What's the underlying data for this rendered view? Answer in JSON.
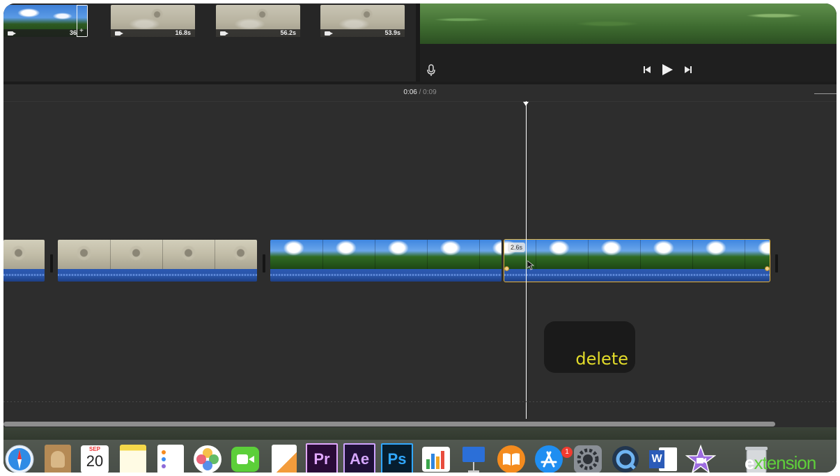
{
  "browser": {
    "clips": [
      {
        "duration": "36",
        "kind": "sky"
      },
      {
        "duration": "16.8s",
        "kind": "water"
      },
      {
        "duration": "56.2s",
        "kind": "water"
      },
      {
        "duration": "53.9s",
        "kind": "water"
      }
    ]
  },
  "viewer": {
    "icons": {
      "mic": "microphone-icon",
      "prev": "skip-back-icon",
      "play": "play-icon",
      "next": "skip-forward-icon"
    }
  },
  "timeline": {
    "current_time": "0:06",
    "separator": "/",
    "total_time": "0:09",
    "selected_clip_duration": "2.6s"
  },
  "tooltip": {
    "text": "delete"
  },
  "dock": {
    "apps": [
      {
        "name": "Safari",
        "icon": "safari-icon"
      },
      {
        "name": "Contacts",
        "icon": "contacts-icon"
      },
      {
        "name": "Calendar",
        "icon": "calendar-icon",
        "month": "SEP",
        "day": "20"
      },
      {
        "name": "Notes",
        "icon": "notes-icon"
      },
      {
        "name": "Reminders",
        "icon": "reminders-icon"
      },
      {
        "name": "Photos",
        "icon": "photos-icon"
      },
      {
        "name": "FaceTime",
        "icon": "facetime-icon"
      },
      {
        "name": "Pages",
        "icon": "pages-icon"
      },
      {
        "name": "Premiere Pro",
        "label": "Pr",
        "icon": "premiere-icon"
      },
      {
        "name": "After Effects",
        "label": "Ae",
        "icon": "after-effects-icon"
      },
      {
        "name": "Photoshop",
        "label": "Ps",
        "icon": "photoshop-icon"
      },
      {
        "name": "Numbers",
        "icon": "numbers-icon"
      },
      {
        "name": "Keynote",
        "icon": "keynote-icon"
      },
      {
        "name": "Books",
        "icon": "books-icon"
      },
      {
        "name": "App Store",
        "icon": "app-store-icon",
        "badge": "1"
      },
      {
        "name": "System Preferences",
        "icon": "gear-icon"
      },
      {
        "name": "QuickTime",
        "icon": "quicktime-icon"
      },
      {
        "name": "Word",
        "label": "W",
        "icon": "word-icon"
      },
      {
        "name": "iMovie",
        "icon": "imovie-icon"
      },
      {
        "name": "Trash",
        "icon": "trash-icon"
      }
    ],
    "watermark": {
      "prefix": "e",
      "rest": "xtension"
    }
  }
}
